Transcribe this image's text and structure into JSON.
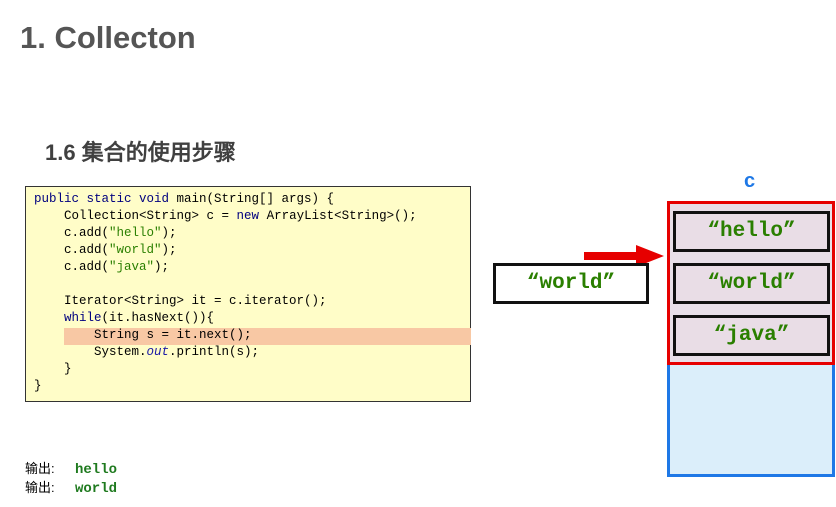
{
  "header": {
    "title": "1. Collecton",
    "subtitle": "1.6 集合的使用步骤"
  },
  "code": {
    "lines": [
      "public static void main(String[] args) {",
      "    Collection<String> c = new ArrayList<String>();",
      "    c.add(\"hello\");",
      "    c.add(\"world\");",
      "    c.add(\"java\");",
      "",
      "    Iterator<String> it = c.iterator();",
      "    while(it.hasNext()){",
      "        String s = it.next();",
      "        System.out.println(s);",
      "    }",
      "}"
    ],
    "highlighted_line": 9
  },
  "output": {
    "label": "输出:",
    "lines": [
      "hello",
      "world"
    ]
  },
  "diagram": {
    "variable_label": "c",
    "elements": [
      "“hello”",
      "“world”",
      "“java”"
    ],
    "current_value": "“world”",
    "colors": {
      "collection_border": "#e60000",
      "container_border": "#1e78e6",
      "container_fill": "#dbeefa",
      "string_text": "#2a7f00",
      "arrow": "#e60000",
      "highlight": "#f8c8a4"
    }
  }
}
